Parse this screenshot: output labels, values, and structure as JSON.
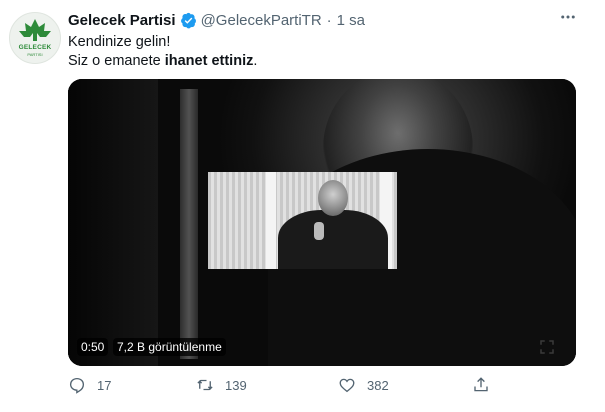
{
  "account": {
    "name": "Gelecek Partisi",
    "handle": "@GelecekPartiTR",
    "separator": "·",
    "time": "1 sa",
    "avatar_text": "GELECEK",
    "avatar_subtext": "PARTISI"
  },
  "tweet": {
    "line1": "Kendinize gelin!",
    "line2_prefix": "Siz o emanete ",
    "line2_bold": "ihanet ettiniz",
    "line2_suffix": "."
  },
  "media": {
    "duration": "0:50",
    "views": "7,2 B görüntülenme"
  },
  "actions": {
    "reply_count": "17",
    "retweet_count": "139",
    "like_count": "382"
  },
  "icons": {
    "more": "more-icon",
    "verified": "verified-badge-icon",
    "reply": "reply-icon",
    "retweet": "retweet-icon",
    "like": "heart-icon",
    "share": "share-icon",
    "expand": "expand-icon"
  },
  "colors": {
    "brand_green": "#2e8b3a",
    "verified_blue": "#1d9bf0",
    "text_primary": "#0f1419",
    "text_secondary": "#536471"
  }
}
